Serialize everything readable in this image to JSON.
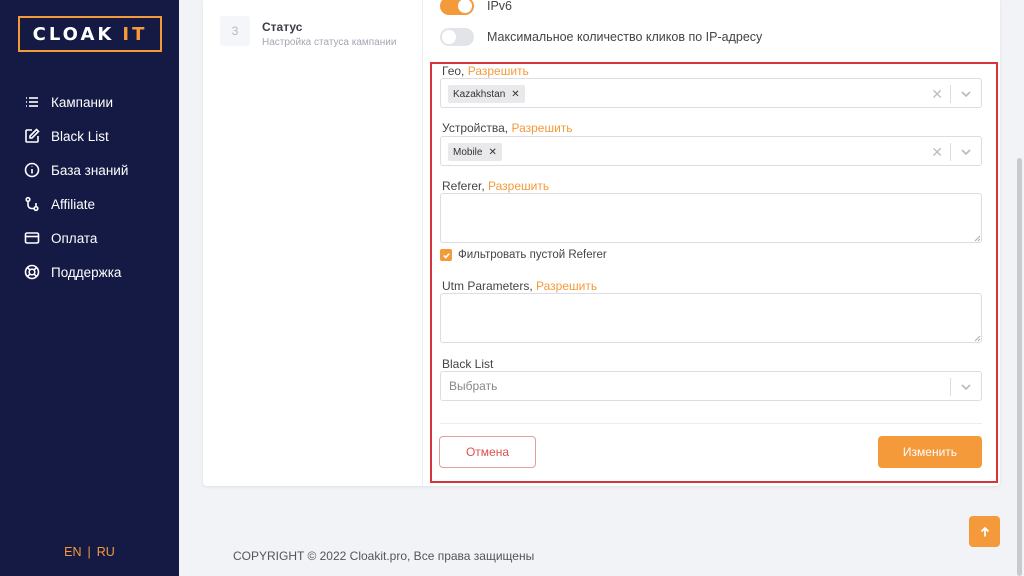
{
  "brand": {
    "name": "CLOAK",
    "accent": "IT",
    "accent_color": "#f49a3a",
    "sidebar_color": "#151a45"
  },
  "nav": [
    {
      "label": "Кампании",
      "icon": "list-icon"
    },
    {
      "label": "Black List",
      "icon": "edit-icon"
    },
    {
      "label": "База знаний",
      "icon": "info-icon"
    },
    {
      "label": "Affiliate",
      "icon": "affiliate-icon"
    },
    {
      "label": "Оплата",
      "icon": "credit-card-icon"
    },
    {
      "label": "Поддержка",
      "icon": "lifebuoy-icon"
    }
  ],
  "lang": {
    "en": "EN",
    "sep": "|",
    "ru": "RU"
  },
  "step": {
    "num": "3",
    "title": "Статус",
    "subtitle": "Настройка статуса кампании"
  },
  "toggles": {
    "ipv6": {
      "label": "IPv6",
      "on": true
    },
    "max_clicks": {
      "label": "Максимальное количество кликов по IP-адресу",
      "on": false
    }
  },
  "form": {
    "geo": {
      "label": "Гео,",
      "mode": "Разрешить",
      "tag": "Kazakhstan"
    },
    "devices": {
      "label": "Устройства,",
      "mode": "Разрешить",
      "tag": "Mobile"
    },
    "referer": {
      "label": "Referer,",
      "mode": "Разрешить",
      "value": ""
    },
    "filter_empty_referer": {
      "label": "Фильтровать пустой Referer",
      "checked": true
    },
    "utm": {
      "label": "Utm Parameters,",
      "mode": "Разрешить",
      "value": ""
    },
    "blacklist": {
      "label": "Black List",
      "placeholder": "Выбрать"
    },
    "cancel": "Отмена",
    "submit": "Изменить"
  },
  "footer": {
    "copyright": "COPYRIGHT © 2022 Cloakit.pro, Все права защищены"
  }
}
